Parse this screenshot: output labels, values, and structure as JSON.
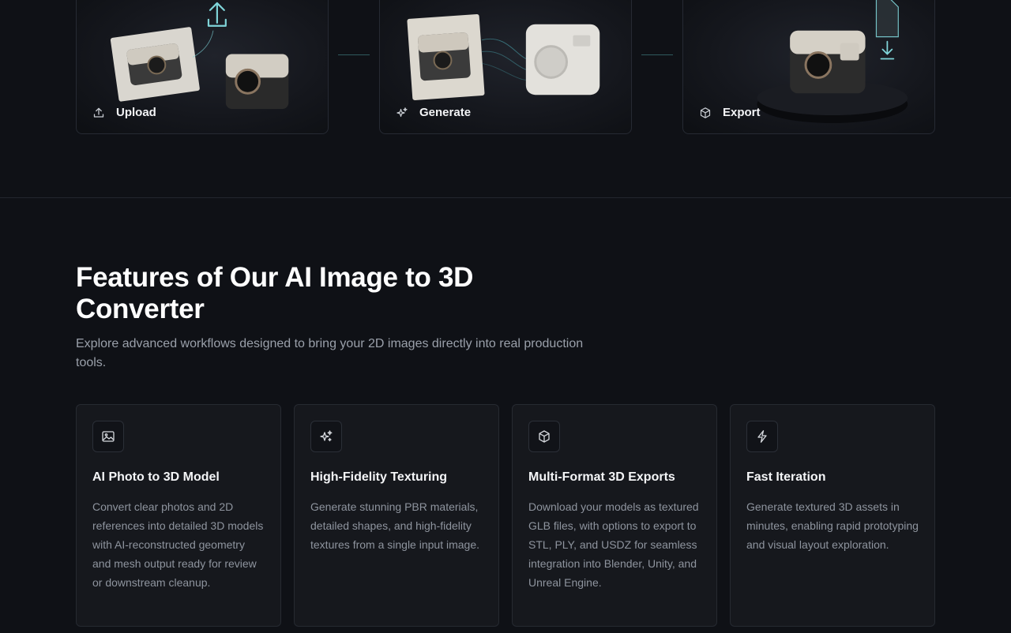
{
  "steps": [
    {
      "label": "Upload",
      "icon": "upload-icon"
    },
    {
      "label": "Generate",
      "icon": "sparkle-icon"
    },
    {
      "label": "Export",
      "icon": "cube-icon"
    }
  ],
  "features": {
    "title": "Features of Our AI Image to 3D Converter",
    "subtitle": "Explore advanced workflows designed to bring your 2D images directly into real production tools.",
    "cards": [
      {
        "icon": "image-icon",
        "title": "AI Photo to 3D Model",
        "desc": "Convert clear photos and 2D references into detailed 3D models with AI-reconstructed geometry and mesh output ready for review or downstream cleanup."
      },
      {
        "icon": "sparkle-icon",
        "title": "High-Fidelity Texturing",
        "desc": "Generate stunning PBR materials, detailed shapes, and high-fidelity textures from a single input image."
      },
      {
        "icon": "cube-icon",
        "title": "Multi-Format 3D Exports",
        "desc": "Download your models as textured GLB files, with options to export to STL, PLY, and USDZ for seamless integration into Blender, Unity, and Unreal Engine."
      },
      {
        "icon": "lightning-icon",
        "title": "Fast Iteration",
        "desc": "Generate textured 3D assets in minutes, enabling rapid prototyping and visual layout exploration."
      }
    ]
  },
  "colors": {
    "background": "#0f1116",
    "card": "#16181d",
    "accent": "#7fd4d8"
  }
}
